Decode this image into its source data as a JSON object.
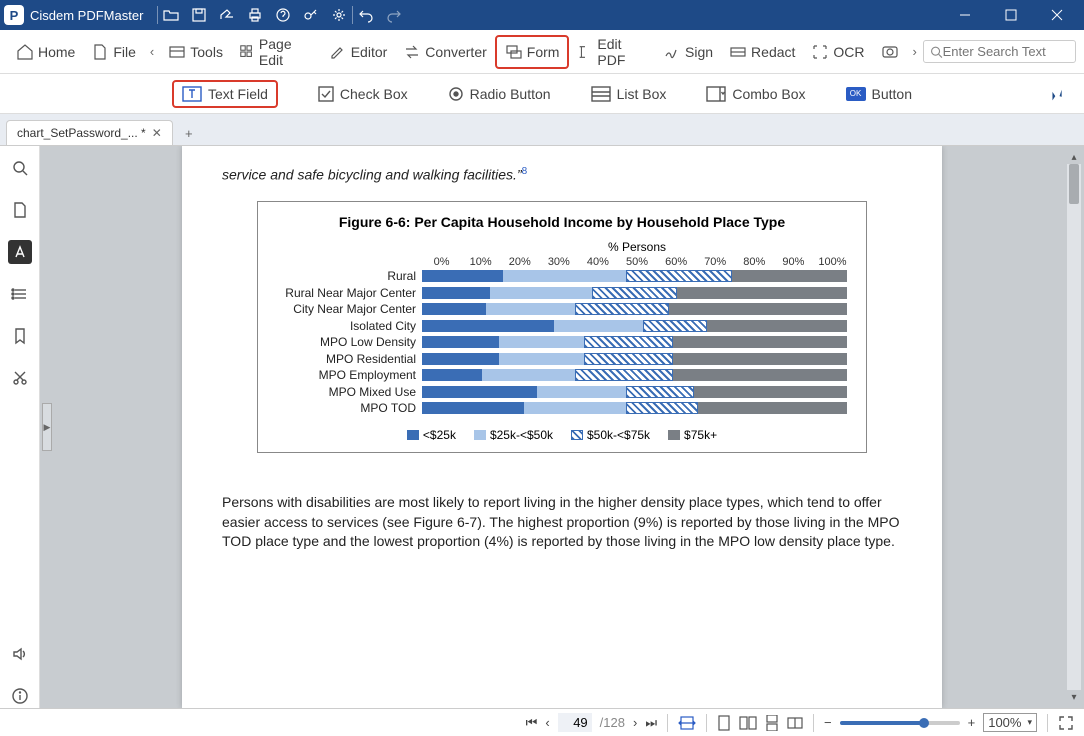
{
  "app": {
    "title": "Cisdem PDFMaster"
  },
  "toolbar": {
    "home": "Home",
    "file": "File",
    "tools": "Tools",
    "page_edit": "Page Edit",
    "editor": "Editor",
    "converter": "Converter",
    "form": "Form",
    "edit_pdf": "Edit PDF",
    "sign": "Sign",
    "redact": "Redact",
    "ocr": "OCR",
    "search_placeholder": "Enter Search Text"
  },
  "form_tools": {
    "text_field": "Text Field",
    "check_box": "Check Box",
    "radio_button": "Radio Button",
    "list_box": "List Box",
    "combo_box": "Combo Box",
    "button": "Button"
  },
  "tab": {
    "label": "chart_SetPassword_... *"
  },
  "document": {
    "quote_fragment": "service and safe bicycling and walking facilities.",
    "quote_close": "”",
    "footnote": "8",
    "body_para": "Persons with disabilities are most likely to report living in the higher density place types, which tend to offer easier access to services (see Figure 6-7). The highest proportion (9%) is reported by those living in the MPO TOD place type and the lowest proportion (4%) is reported by those living in the MPO low density place type."
  },
  "status": {
    "current_page": "49",
    "total_pages": "/128",
    "zoom": "100%"
  },
  "chart_data": {
    "type": "bar",
    "title": "Figure 6-6:  Per Capita Household Income by Household Place Type",
    "xlabel": "% Persons",
    "xlim": [
      0,
      100
    ],
    "ticks": [
      "0%",
      "10%",
      "20%",
      "30%",
      "40%",
      "50%",
      "60%",
      "70%",
      "80%",
      "90%",
      "100%"
    ],
    "categories": [
      "Rural",
      "Rural Near Major Center",
      "City Near Major Center",
      "Isolated City",
      "MPO Low Density",
      "MPO Residential",
      "MPO Employment",
      "MPO Mixed Use",
      "MPO TOD"
    ],
    "series": [
      {
        "name": "<$25k",
        "values": [
          19,
          16,
          15,
          31,
          18,
          18,
          14,
          27,
          24
        ]
      },
      {
        "name": "$25k-<$50k",
        "values": [
          29,
          24,
          21,
          21,
          20,
          20,
          22,
          21,
          24
        ]
      },
      {
        "name": "$50k-<$75k",
        "values": [
          25,
          20,
          22,
          15,
          21,
          21,
          23,
          16,
          17
        ]
      },
      {
        "name": "$75k+",
        "values": [
          27,
          40,
          42,
          33,
          41,
          41,
          41,
          36,
          35
        ]
      }
    ]
  }
}
